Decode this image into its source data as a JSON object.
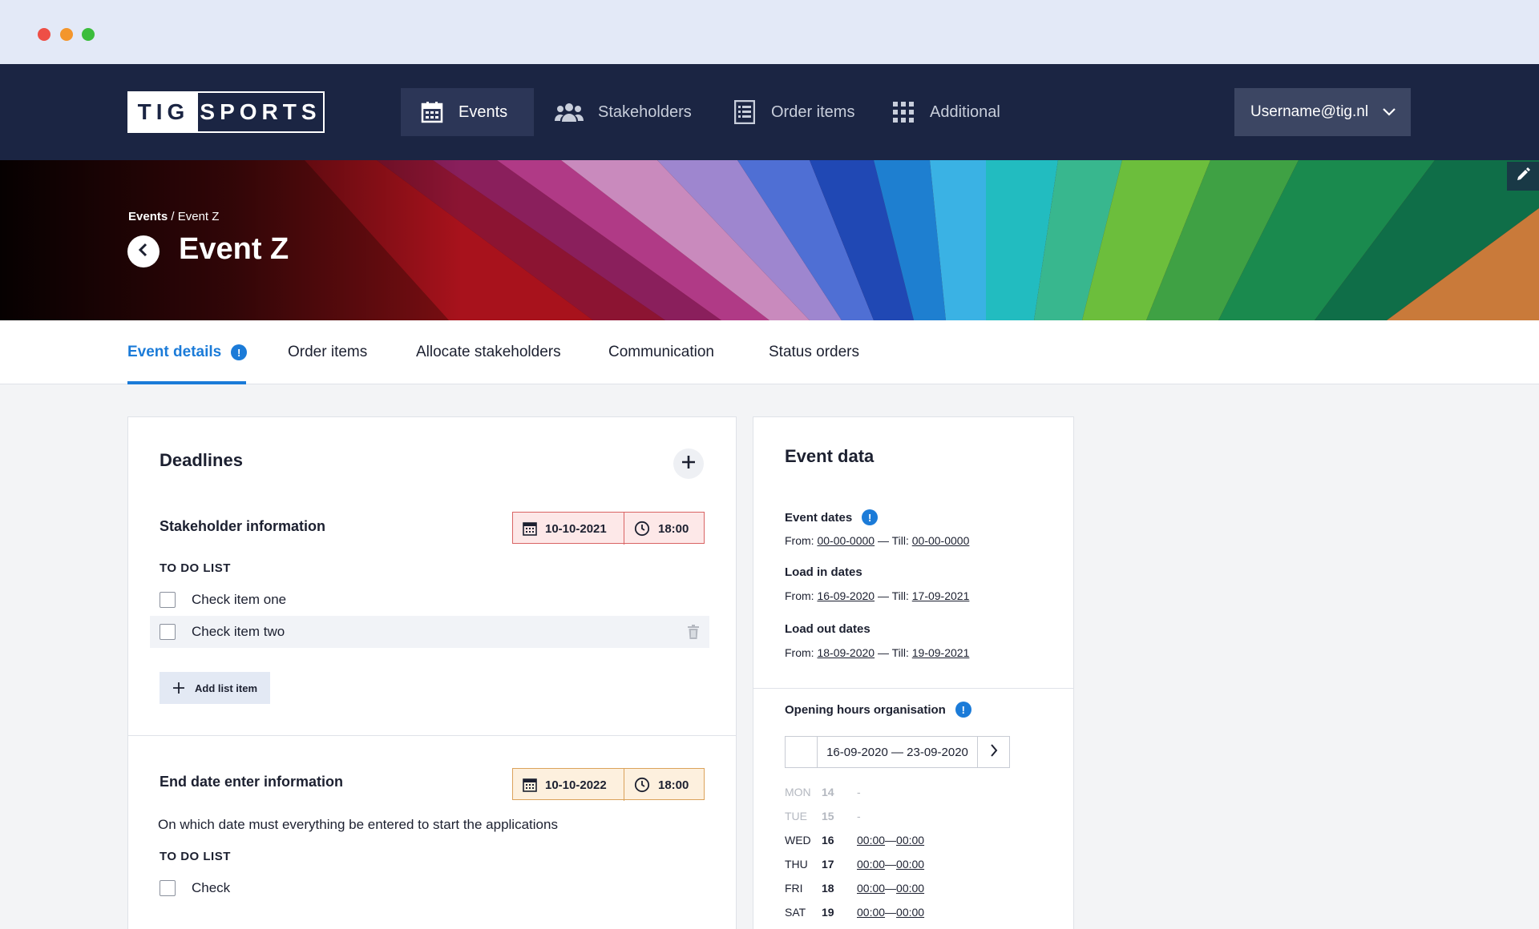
{
  "window": {
    "controls": [
      "close",
      "minimize",
      "maximize"
    ]
  },
  "brand": {
    "logo_left": "TIG",
    "logo_right": "SPORTS"
  },
  "nav": {
    "items": [
      {
        "label": "Events",
        "icon": "calendar-icon",
        "active": true
      },
      {
        "label": "Stakeholders",
        "icon": "users-icon",
        "active": false
      },
      {
        "label": "Order items",
        "icon": "list-icon",
        "active": false
      },
      {
        "label": "Additional",
        "icon": "grid-icon",
        "active": false
      }
    ],
    "user": "Username@tig.nl"
  },
  "hero": {
    "breadcrumb_root": "Events",
    "breadcrumb_sep": " / ",
    "breadcrumb_current": "Event Z",
    "title": "Event Z"
  },
  "tabs": [
    {
      "label": "Event details",
      "active": true,
      "alert": "!"
    },
    {
      "label": "Order items"
    },
    {
      "label": "Allocate stakeholders"
    },
    {
      "label": "Communication"
    },
    {
      "label": "Status orders"
    }
  ],
  "deadlines": {
    "title": "Deadlines",
    "sections": [
      {
        "title": "Stakeholder information",
        "date": "10-10-2021",
        "time": "18:00",
        "status": "overdue",
        "todo_label": "TO DO LIST",
        "items": [
          "Check item one",
          "Check item two"
        ],
        "add_label": "Add list item"
      },
      {
        "title": "End date enter information",
        "date": "10-10-2022",
        "time": "18:00",
        "status": "upcoming",
        "description": "On which date must everything be entered to start the applications",
        "todo_label": "TO DO LIST",
        "items": [
          "Check"
        ]
      }
    ]
  },
  "event_data": {
    "title": "Event data",
    "groups": [
      {
        "label": "Event dates",
        "has_info": true,
        "from_label": "From: ",
        "from": "00-00-0000",
        "sep": " — Till: ",
        "till": "00-00-0000"
      },
      {
        "label": "Load in dates",
        "from_label": "From: ",
        "from": "16-09-2020",
        "sep": " — Till: ",
        "till": "17-09-2021"
      },
      {
        "label": "Load out dates",
        "from_label": "From: ",
        "from": "18-09-2020",
        "sep": " — Till: ",
        "till": "19-09-2021"
      }
    ],
    "opening_hours": {
      "label": "Opening hours organisation",
      "range": "16-09-2020 — 23-09-2020",
      "days": [
        {
          "day": "MON",
          "num": "14",
          "empty": "-"
        },
        {
          "day": "TUE",
          "num": "15",
          "empty": "-"
        },
        {
          "day": "WED",
          "num": "16",
          "open": "00:00",
          "sep": " — ",
          "close": "00:00"
        },
        {
          "day": "THU",
          "num": "17",
          "open": "00:00",
          "sep": " — ",
          "close": "00:00"
        },
        {
          "day": "FRI",
          "num": "18",
          "open": "00:00",
          "sep": " — ",
          "close": "00:00"
        },
        {
          "day": "SAT",
          "num": "19",
          "open": "00:00",
          "sep": " — ",
          "close": "00:00"
        }
      ]
    }
  },
  "colors": {
    "navbar": "#1b2543",
    "accent": "#1b7bd8",
    "overdue": "#d96464",
    "upcoming": "#dba25b"
  }
}
